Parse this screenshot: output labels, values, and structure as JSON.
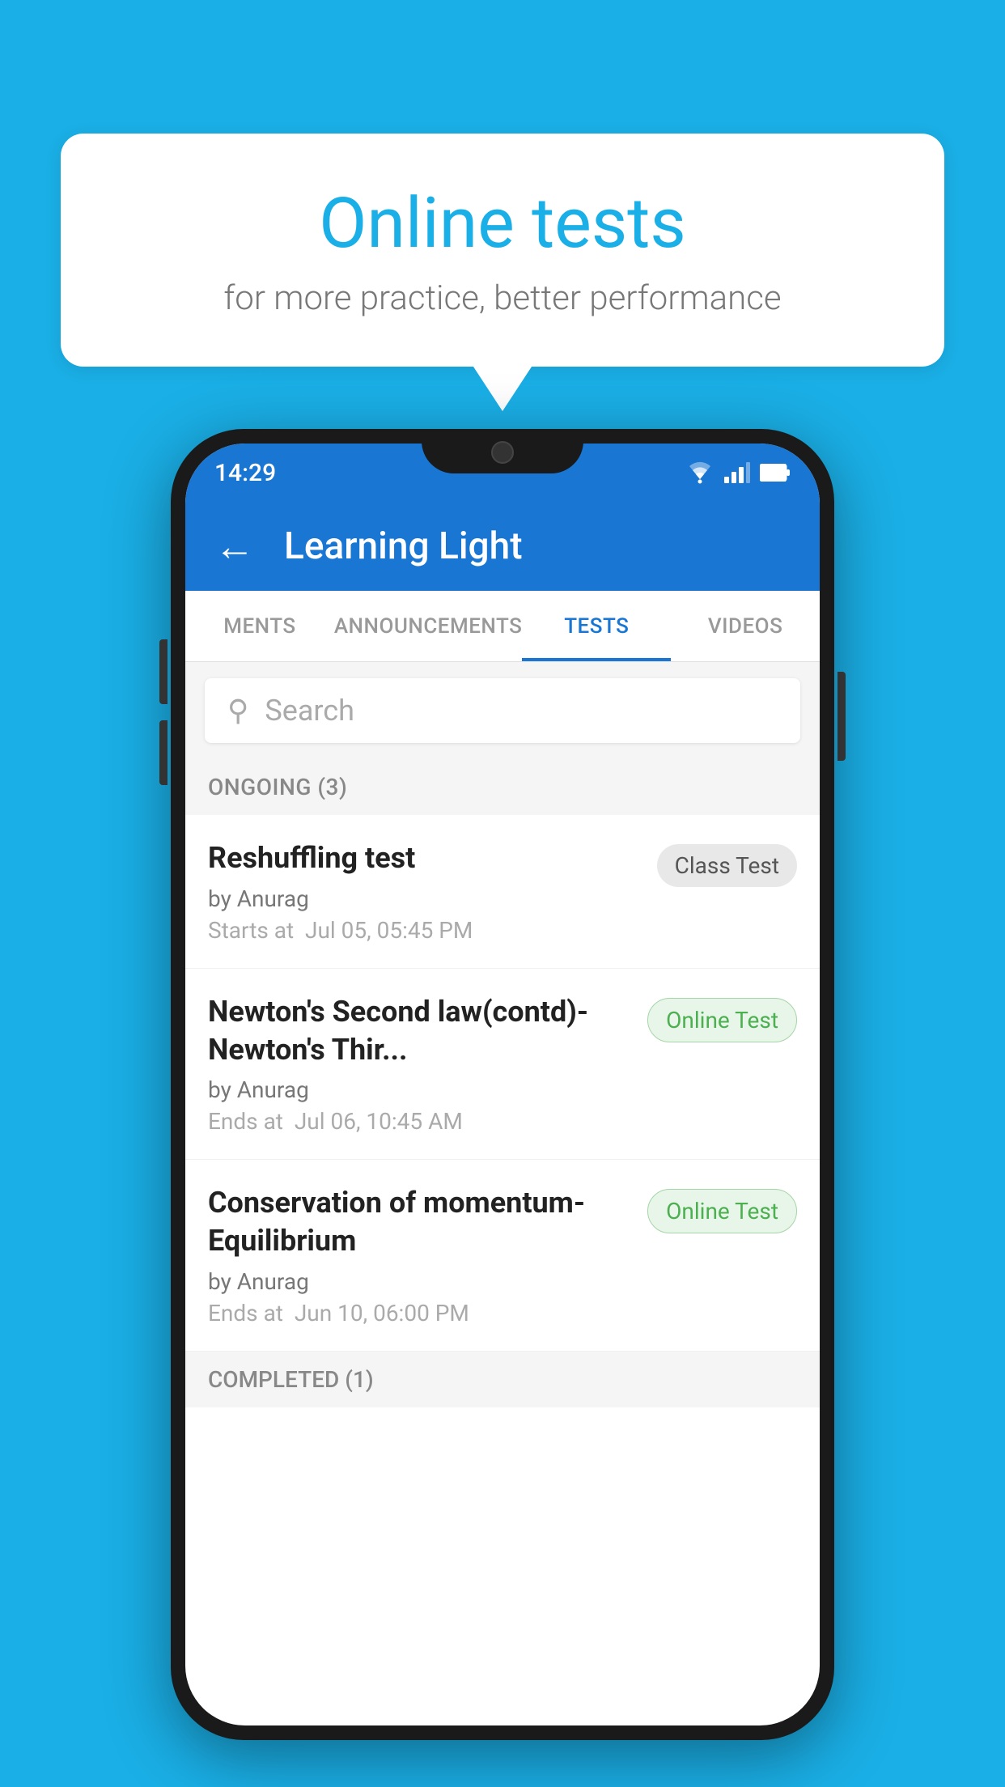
{
  "background_color": "#1AAFE6",
  "speech_bubble": {
    "title": "Online tests",
    "subtitle": "for more practice, better performance"
  },
  "phone": {
    "status_bar": {
      "time": "14:29"
    },
    "app_bar": {
      "title": "Learning Light",
      "back_label": "←"
    },
    "tabs": [
      {
        "label": "MENTS",
        "active": false
      },
      {
        "label": "ANNOUNCEMENTS",
        "active": false
      },
      {
        "label": "TESTS",
        "active": true
      },
      {
        "label": "VIDEOS",
        "active": false
      }
    ],
    "search": {
      "placeholder": "Search"
    },
    "ongoing_section": {
      "header": "ONGOING (3)",
      "tests": [
        {
          "title": "Reshuffling test",
          "author": "by Anurag",
          "time_label": "Starts at",
          "time_value": "Jul 05, 05:45 PM",
          "badge": "Class Test",
          "badge_type": "class"
        },
        {
          "title": "Newton's Second law(contd)-Newton's Thir...",
          "author": "by Anurag",
          "time_label": "Ends at",
          "time_value": "Jul 06, 10:45 AM",
          "badge": "Online Test",
          "badge_type": "online"
        },
        {
          "title": "Conservation of momentum-Equilibrium",
          "author": "by Anurag",
          "time_label": "Ends at",
          "time_value": "Jun 10, 06:00 PM",
          "badge": "Online Test",
          "badge_type": "online"
        }
      ]
    },
    "completed_section": {
      "header": "COMPLETED (1)"
    }
  }
}
